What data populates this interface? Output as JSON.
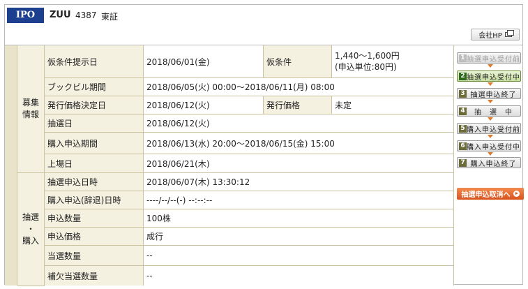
{
  "header": {
    "badge": "IPO",
    "name": "ZUU",
    "code": "4387",
    "market": "東証",
    "hp_button": "会社HP"
  },
  "sections": {
    "boshu": "募集\n情報",
    "chusen": "抽選\n・\n購入"
  },
  "boshu_rows": [
    {
      "label": "仮条件提示日",
      "value": "2018/06/01(金)",
      "label2": "仮条件",
      "value2": "1,440～1,600円\n(申込単位:80円)"
    },
    {
      "label": "ブックビル期間",
      "value": "2018/06/05(火) 00:00～2018/06/11(月) 08:00"
    },
    {
      "label": "発行価格決定日",
      "value": "2018/06/12(火)",
      "label2": "発行価格",
      "value2": "未定"
    },
    {
      "label": "抽選日",
      "value": "2018/06/12(火)"
    },
    {
      "label": "購入申込期間",
      "value": "2018/06/13(水) 20:00～2018/06/15(金) 15:00"
    },
    {
      "label": "上場日",
      "value": "2018/06/21(木)"
    }
  ],
  "chusen_rows": [
    {
      "label": "抽選申込日時",
      "value": "2018/06/07(木) 13:30:12"
    },
    {
      "label": "購入申込(辞退)日時",
      "value": "----/--/--(-) --:--:--"
    },
    {
      "label": "申込数量",
      "value": "100株"
    },
    {
      "label": "申込価格",
      "value": "成行"
    },
    {
      "label": "当選数量",
      "value": "--"
    },
    {
      "label": "補欠当選数量",
      "value": "--"
    }
  ],
  "steps": [
    {
      "num": "1",
      "label": "抽選申込受付前",
      "state": "disabled"
    },
    {
      "num": "2",
      "label": "抽選申込受付中",
      "state": "active"
    },
    {
      "num": "3",
      "label": "抽選申込終了",
      "state": "normal"
    },
    {
      "num": "4",
      "label": "抽　選　中",
      "state": "normal"
    },
    {
      "num": "5",
      "label": "購入申込受付前",
      "state": "normal"
    },
    {
      "num": "6",
      "label": "購入申込受付中",
      "state": "normal"
    },
    {
      "num": "7",
      "label": "購入申込終了",
      "state": "normal"
    }
  ],
  "cancel_button": "抽選申込取消へ",
  "colors": {
    "badge": "#1c3f8f",
    "label_bg": "#f4f1e1",
    "active_step": "#2d6b1a",
    "cancel": "#d9531e",
    "arrow": "#e07b2c"
  }
}
